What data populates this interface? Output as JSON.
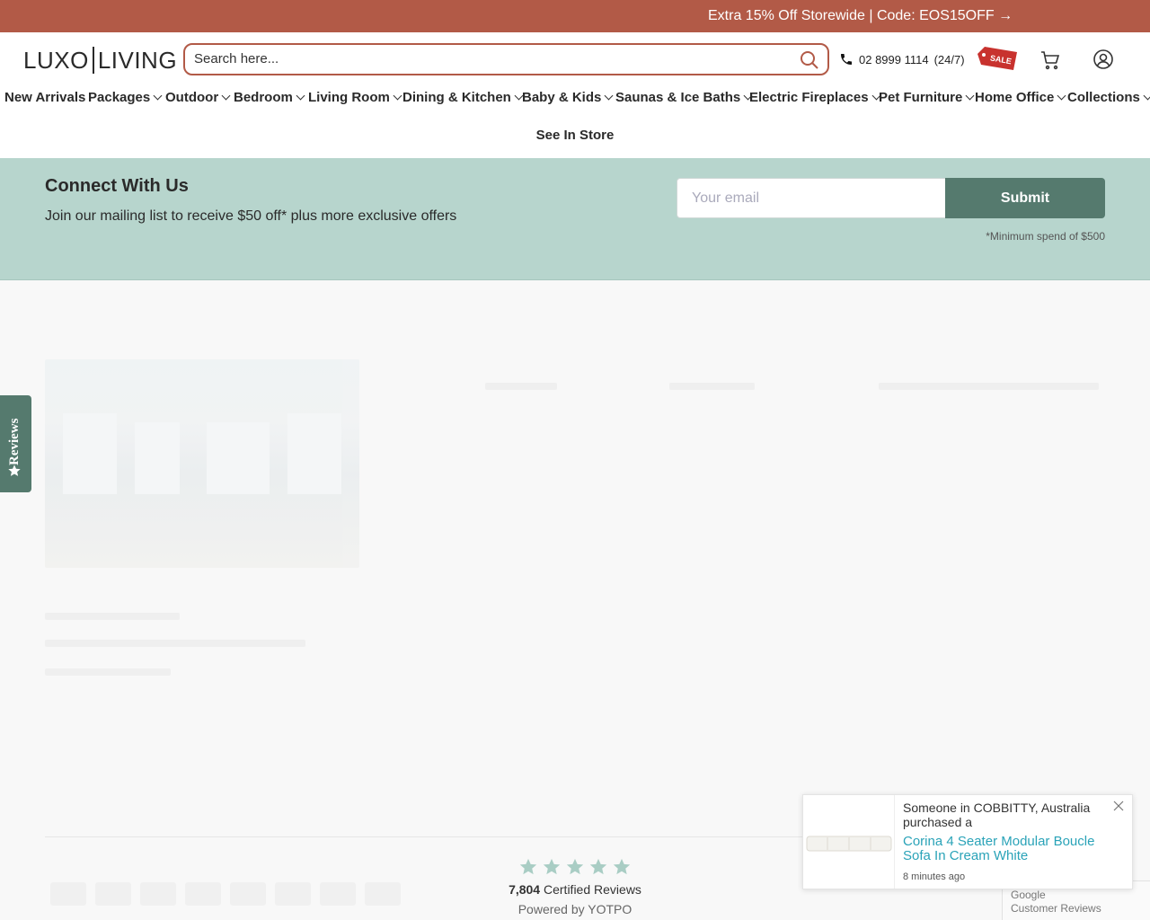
{
  "promo": {
    "text": "Extra 15% Off Storewide | Code: EOS15OFF →",
    "bg_color": "#b25a47"
  },
  "header": {
    "logo_left": "LUXO",
    "logo_right": "LIVING",
    "search_placeholder": "Search here...",
    "phone": "02 8999 1114",
    "phone_hours": "(24/7)",
    "sale_tag": "SALE"
  },
  "nav": {
    "items": [
      {
        "label": "New Arrivals",
        "dropdown": false
      },
      {
        "label": "Packages",
        "dropdown": true
      },
      {
        "label": "Outdoor",
        "dropdown": true
      },
      {
        "label": "Bedroom",
        "dropdown": true
      },
      {
        "label": "Living Room",
        "dropdown": true
      },
      {
        "label": "Dining & Kitchen",
        "dropdown": true
      },
      {
        "label": "Baby & Kids",
        "dropdown": true
      },
      {
        "label": "Saunas & Ice Baths",
        "dropdown": true
      },
      {
        "label": "Electric Fireplaces",
        "dropdown": true
      },
      {
        "label": "Pet Furniture",
        "dropdown": true
      },
      {
        "label": "Home Office",
        "dropdown": true
      },
      {
        "label": "Collections",
        "dropdown": true
      }
    ],
    "see_in_store": "See In Store"
  },
  "connect": {
    "title": "Connect With Us",
    "subtitle": "Join our mailing list to receive $50 off* plus more exclusive offers",
    "email_placeholder": "Your email",
    "submit_label": "Submit",
    "note": "*Minimum spend of $500",
    "bg_color": "#b7d5cd",
    "button_color": "#557a6e"
  },
  "reviews_summary": {
    "count": "7,804",
    "count_label": "Certified Reviews",
    "powered_by": "Powered by YOTPO",
    "star_color": "#a9cdc4"
  },
  "reviews_tab": {
    "label": "Reviews"
  },
  "google_badge": {
    "line1": "Google",
    "line2": "Customer Reviews"
  },
  "purchase_popup": {
    "who": "Someone in COBBITTY, Australia purchased a",
    "product": "Corina 4 Seater Modular Boucle Sofa In Cream White",
    "time": "8 minutes ago"
  }
}
